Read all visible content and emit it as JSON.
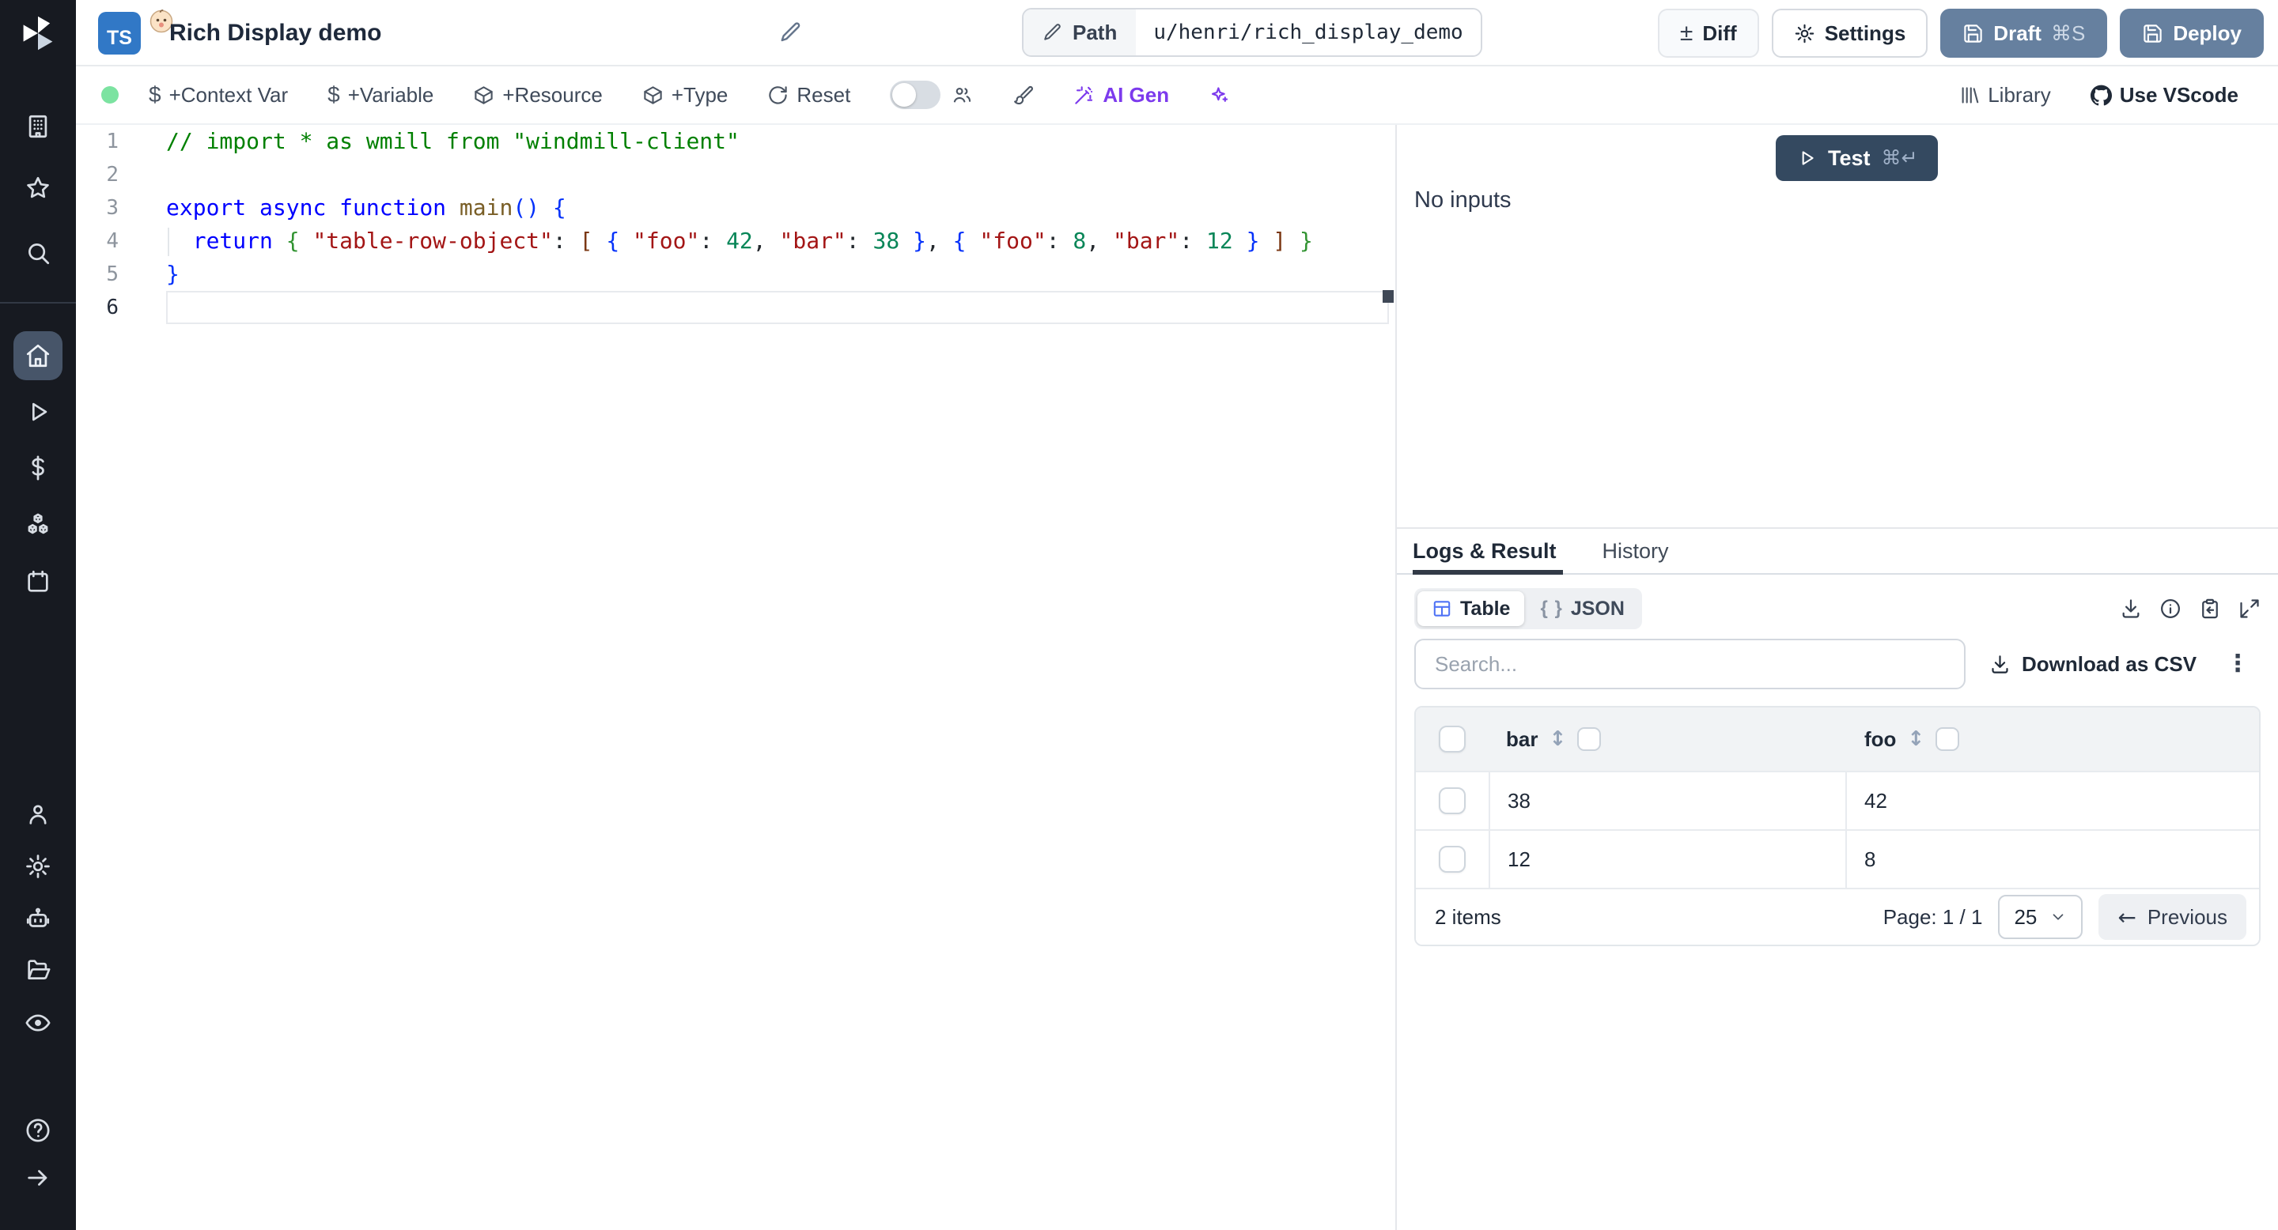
{
  "topbar": {
    "lang_badge": "TS",
    "title": "Rich Display demo",
    "path_label": "Path",
    "path_value": "u/henri/rich_display_demo",
    "diff_label": "Diff",
    "settings_label": "Settings",
    "draft_label": "Draft",
    "draft_shortcut": "⌘S",
    "deploy_label": "Deploy"
  },
  "toolbar": {
    "context_var": "+Context Var",
    "variable": "+Variable",
    "resource": "+Resource",
    "type": "+Type",
    "reset": "Reset",
    "ai_gen": "AI Gen",
    "library": "Library",
    "use_vscode": "Use VScode"
  },
  "icons": {
    "diff_glyph": "±",
    "kebab_glyph": "⋮",
    "braces_glyph": "{ }",
    "sort_glyph": "↕",
    "prev_arrow_glyph": "←",
    "dollar_glyph": "$",
    "help_glyph": "?"
  },
  "colors": {
    "slate_button": "#66809f",
    "test_button": "#344960",
    "ai_purple": "#7c3aed",
    "status_green": "#7ce3a1",
    "table_icon_blue": "#4f72f5",
    "ts_badge_blue": "#3178c6",
    "sidebar_bg": "#171a21",
    "active_item_bg": "#475569"
  },
  "editor": {
    "lines": [
      {
        "num": "1",
        "current": false,
        "tokens": [
          {
            "t": "// import * as wmill from \"windmill-client\"",
            "c": "cm"
          }
        ]
      },
      {
        "num": "2",
        "current": false,
        "tokens": []
      },
      {
        "num": "3",
        "current": false,
        "tokens": [
          {
            "t": "export",
            "c": "kw"
          },
          {
            "t": " ",
            "c": "pl"
          },
          {
            "t": "async",
            "c": "kw"
          },
          {
            "t": " ",
            "c": "pl"
          },
          {
            "t": "function",
            "c": "kw"
          },
          {
            "t": " ",
            "c": "pl"
          },
          {
            "t": "main",
            "c": "fn"
          },
          {
            "t": "(",
            "c": "b1"
          },
          {
            "t": ")",
            "c": "b1"
          },
          {
            "t": " ",
            "c": "pl"
          },
          {
            "t": "{",
            "c": "b1"
          }
        ]
      },
      {
        "num": "4",
        "current": false,
        "tokens": [
          {
            "t": "  ",
            "c": "pl"
          },
          {
            "t": "return",
            "c": "kw"
          },
          {
            "t": " ",
            "c": "pl"
          },
          {
            "t": "{",
            "c": "b2"
          },
          {
            "t": " \"table-row-object\"",
            "c": "str"
          },
          {
            "t": ": ",
            "c": "pl"
          },
          {
            "t": "[",
            "c": "b3"
          },
          {
            "t": " ",
            "c": "pl"
          },
          {
            "t": "{",
            "c": "b1"
          },
          {
            "t": " \"foo\"",
            "c": "str"
          },
          {
            "t": ": ",
            "c": "pl"
          },
          {
            "t": "42",
            "c": "num"
          },
          {
            "t": ", ",
            "c": "pl"
          },
          {
            "t": "\"bar\"",
            "c": "str"
          },
          {
            "t": ": ",
            "c": "pl"
          },
          {
            "t": "38",
            "c": "num"
          },
          {
            "t": " ",
            "c": "pl"
          },
          {
            "t": "}",
            "c": "b1"
          },
          {
            "t": ", ",
            "c": "pl"
          },
          {
            "t": "{",
            "c": "b1"
          },
          {
            "t": " \"foo\"",
            "c": "str"
          },
          {
            "t": ": ",
            "c": "pl"
          },
          {
            "t": "8",
            "c": "num"
          },
          {
            "t": ", ",
            "c": "pl"
          },
          {
            "t": "\"bar\"",
            "c": "str"
          },
          {
            "t": ": ",
            "c": "pl"
          },
          {
            "t": "12",
            "c": "num"
          },
          {
            "t": " ",
            "c": "pl"
          },
          {
            "t": "}",
            "c": "b1"
          },
          {
            "t": " ",
            "c": "pl"
          },
          {
            "t": "]",
            "c": "b3"
          },
          {
            "t": " ",
            "c": "pl"
          },
          {
            "t": "}",
            "c": "b2"
          }
        ]
      },
      {
        "num": "5",
        "current": false,
        "tokens": [
          {
            "t": "}",
            "c": "b1"
          }
        ]
      },
      {
        "num": "6",
        "current": true,
        "tokens": []
      }
    ]
  },
  "run_panel": {
    "test_label": "Test",
    "test_shortcut": "⌘↵",
    "no_inputs": "No inputs"
  },
  "result_panel": {
    "tabs": {
      "logs": "Logs & Result",
      "history": "History"
    },
    "view_toggle": {
      "table": "Table",
      "json": "JSON"
    },
    "search_placeholder": "Search...",
    "download_csv": "Download as CSV",
    "table": {
      "columns": [
        "bar",
        "foo"
      ],
      "rows": [
        [
          "38",
          "42"
        ],
        [
          "12",
          "8"
        ]
      ]
    },
    "footer": {
      "items": "2 items",
      "page": "Page: 1 / 1",
      "page_size": "25",
      "previous": "Previous"
    }
  }
}
